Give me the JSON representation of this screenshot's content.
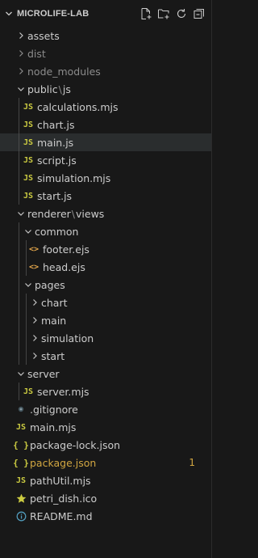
{
  "explorer": {
    "title": "MICROLIFE-LAB",
    "actions": [
      {
        "name": "new-file-icon"
      },
      {
        "name": "new-folder-icon"
      },
      {
        "name": "refresh-icon"
      },
      {
        "name": "collapse-all-icon"
      }
    ]
  },
  "tree": {
    "assets": "assets",
    "dist": "dist",
    "node_modules": "node_modules",
    "public": "public",
    "public_sep": "\\",
    "public_js": "js",
    "public_files": [
      "calculations.mjs",
      "chart.js",
      "main.js",
      "script.js",
      "simulation.mjs",
      "start.js"
    ],
    "renderer": "renderer",
    "renderer_sep": "\\",
    "renderer_views": "views",
    "common": "common",
    "common_files": [
      "footer.ejs",
      "head.ejs"
    ],
    "pages": "pages",
    "pages_folders": [
      "chart",
      "main",
      "simulation",
      "start"
    ],
    "server": "server",
    "server_file": "server.mjs",
    "root_files": {
      "gitignore": ".gitignore",
      "main": "main.mjs",
      "package_lock": "package-lock.json",
      "package": "package.json",
      "package_badge": "1",
      "pathutil": "pathUtil.mjs",
      "petri": "petri_dish.ico",
      "readme": "README.md"
    },
    "icon_text": {
      "js": "JS",
      "json": "{ }",
      "ejs": "<>"
    }
  },
  "colors": {
    "background": "#181818",
    "selected_row": "#2a2d2e",
    "js_icon": "#cbcb41",
    "modified": "#d1a641",
    "info_icon": "#519aba",
    "star_icon": "#cbcb41"
  }
}
